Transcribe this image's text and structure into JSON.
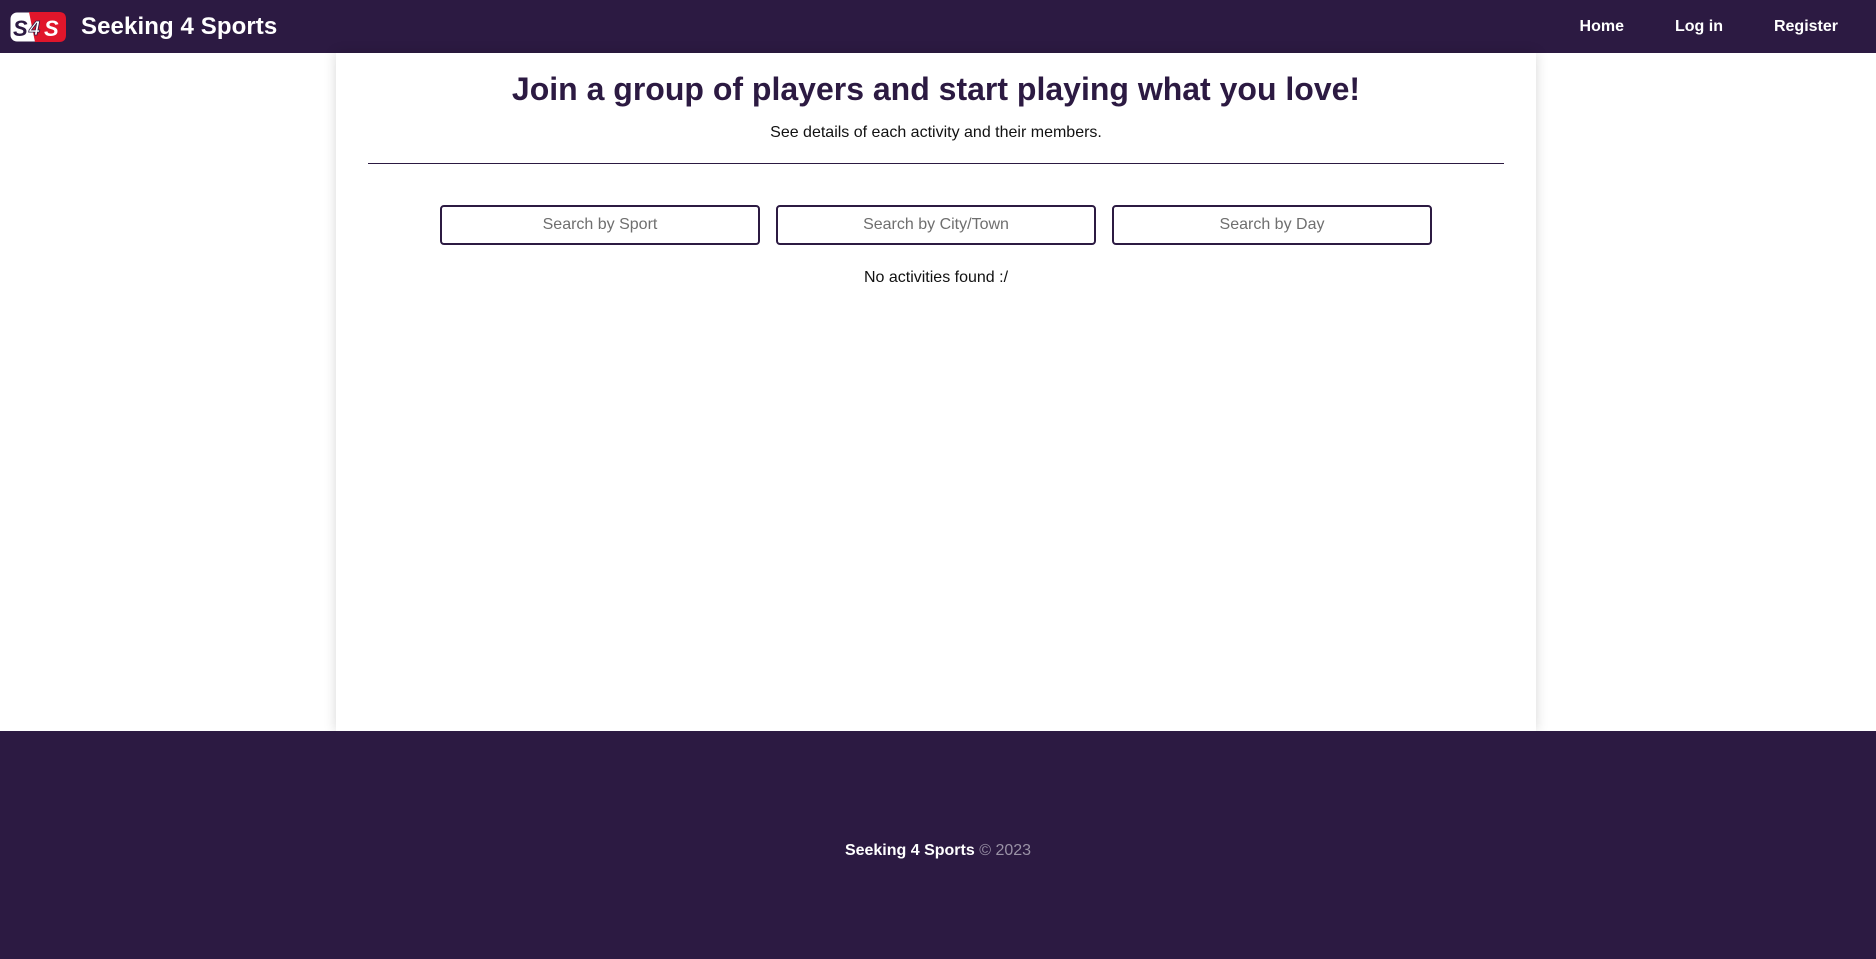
{
  "navbar": {
    "logo_text": "S4S",
    "brand": "Seeking 4 Sports",
    "links": [
      {
        "label": "Home"
      },
      {
        "label": "Log in"
      },
      {
        "label": "Register"
      }
    ]
  },
  "main": {
    "title": "Join a group of players and start playing what you love!",
    "subtitle": "See details of each activity and their members.",
    "search": {
      "sport_placeholder": "Search by Sport",
      "city_placeholder": "Search by City/Town",
      "day_placeholder": "Search by Day"
    },
    "empty_message": "No activities found :/"
  },
  "footer": {
    "brand": "Seeking 4 Sports",
    "copyright": "© 2023"
  },
  "colors": {
    "primary": "#2c1a42",
    "logo_red": "#e0162b",
    "background": "#ffffff"
  },
  "icons": {
    "logo": "s4s-logo-icon"
  }
}
